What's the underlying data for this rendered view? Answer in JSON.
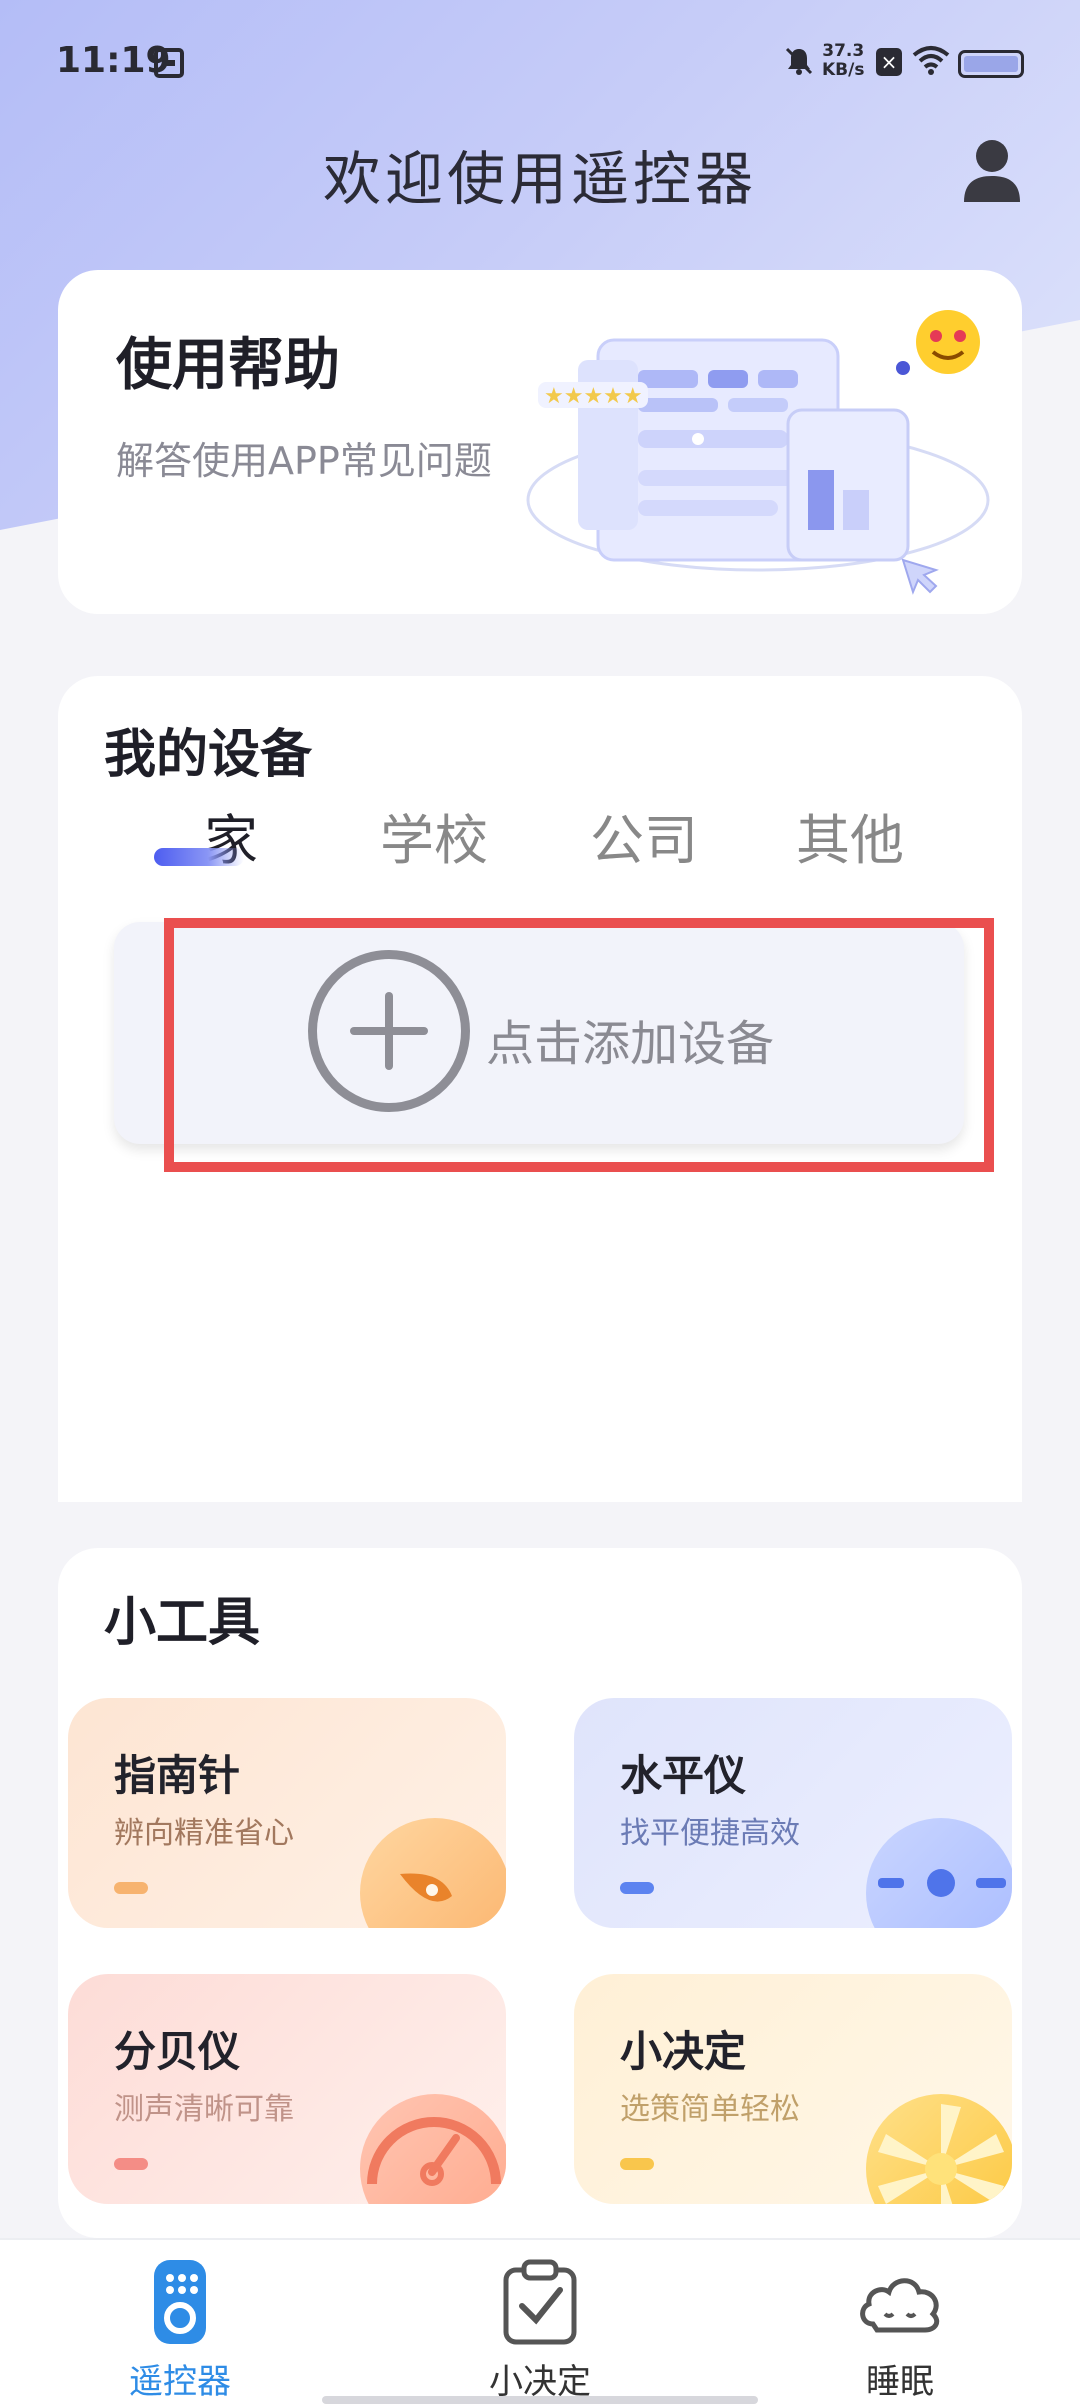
{
  "status": {
    "time": "11:19",
    "net_speed_value": "37.3",
    "net_speed_unit": "KB/s",
    "x_badge": "×"
  },
  "header": {
    "title": "欢迎使用遥控器"
  },
  "help": {
    "title": "使用帮助",
    "subtitle": "解答使用APP常见问题"
  },
  "devices": {
    "title": "我的设备",
    "tabs": [
      "家",
      "学校",
      "公司",
      "其他"
    ],
    "active_tab": "家",
    "add_label": "点击添加设备"
  },
  "tools": {
    "title": "小工具",
    "items": [
      {
        "name": "指南针",
        "desc": "辨向精准省心"
      },
      {
        "name": "水平仪",
        "desc": "找平便捷高效"
      },
      {
        "name": "分贝仪",
        "desc": "测声清晰可靠"
      },
      {
        "name": "小决定",
        "desc": "选策简单轻松"
      }
    ]
  },
  "nav": {
    "items": [
      {
        "label": "遥控器",
        "icon": "remote-icon",
        "active": true
      },
      {
        "label": "小决定",
        "icon": "clipboard-check-icon",
        "active": false
      },
      {
        "label": "睡眠",
        "icon": "cloud-sleep-icon",
        "active": false
      }
    ]
  },
  "colors": {
    "accent_blue": "#2e8ce6",
    "tab_indicator": "#4d5df0",
    "highlight_red": "#ea4f4f"
  }
}
